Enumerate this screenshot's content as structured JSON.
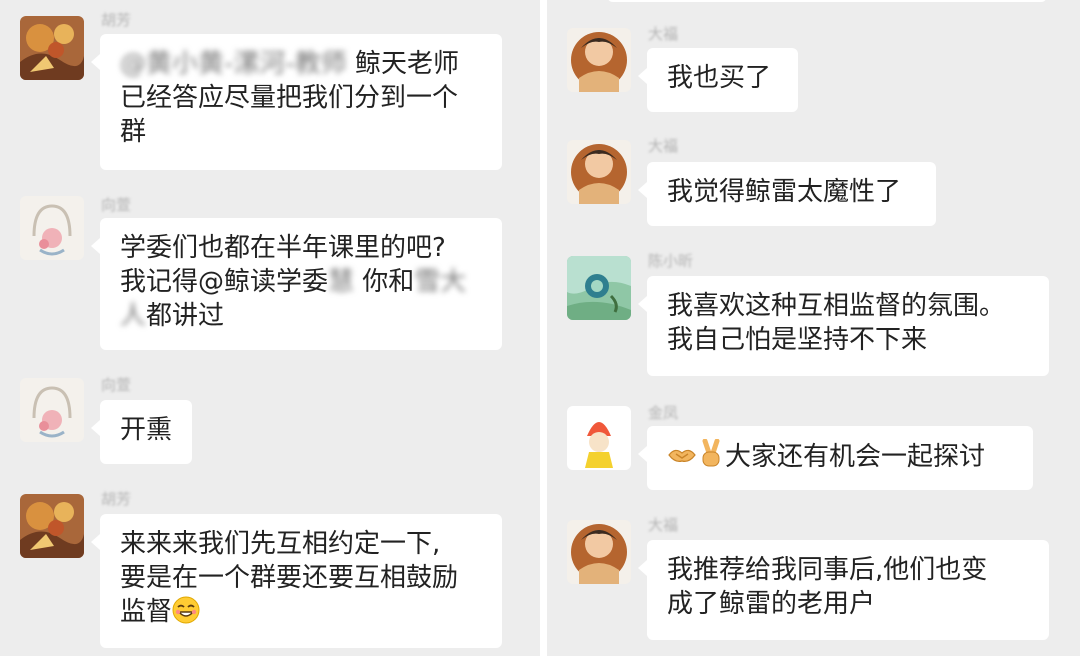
{
  "left": {
    "messages": [
      {
        "sender": "胡芳",
        "lines": [
          {
            "blurred": "@黄小黄-漯河-教师",
            "text": " 鲸天老师"
          },
          {
            "text": "已经答应尽量把我们分到一个"
          },
          {
            "text": "群"
          }
        ]
      },
      {
        "sender": "向萱",
        "lines": [
          {
            "text": "学委们也都在半年课里的吧?"
          },
          {
            "text": "我记得@鲸读学委",
            "blurred": "慧",
            "text2": " 你和",
            "blurred2": "雪大"
          },
          {
            "blurred": "人",
            "text": "都讲过"
          }
        ]
      },
      {
        "sender": "向萱",
        "lines": [
          {
            "text": "开熏"
          }
        ]
      },
      {
        "sender": "胡芳",
        "lines": [
          {
            "text": "来来来我们先互相约定一下,"
          },
          {
            "text": "要是在一个群要还要互相鼓励"
          },
          {
            "text": "监督",
            "emoji": "grinning-emoji"
          }
        ]
      }
    ]
  },
  "right": {
    "messages": [
      {
        "sender": "大福",
        "lines": [
          {
            "text": "我也买了"
          }
        ]
      },
      {
        "sender": "大福",
        "lines": [
          {
            "text": "我觉得鲸雷太魔性了"
          }
        ]
      },
      {
        "sender": "陈小昕",
        "lines": [
          {
            "text": "我喜欢这种互相监督的氛围。"
          },
          {
            "text": "我自己怕是坚持不下来"
          }
        ]
      },
      {
        "sender": "金凤",
        "lines": [
          {
            "prefix_emojis": [
              "handshake-emoji",
              "victory-hand-emoji"
            ],
            "text": "大家还有机会一起探讨"
          }
        ]
      },
      {
        "sender": "大福",
        "lines": [
          {
            "text": "我推荐给我同事后,他们也变"
          },
          {
            "text": "成了鲸雷的老用户"
          }
        ]
      }
    ]
  },
  "colors": {
    "chat_background": "#ededed",
    "bubble": "#ffffff",
    "text": "#222222",
    "sender_name": "#b3b3b3"
  }
}
